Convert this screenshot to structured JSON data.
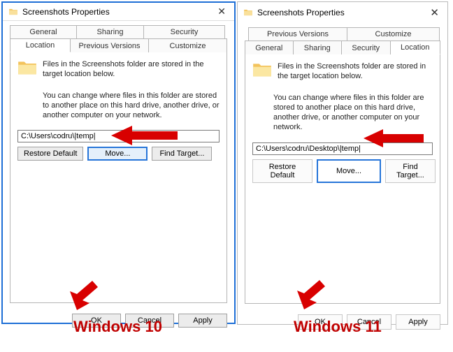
{
  "win10": {
    "title": "Screenshots Properties",
    "tabs_row1": [
      "General",
      "Sharing",
      "Security"
    ],
    "tabs_row2": [
      "Location",
      "Previous Versions",
      "Customize"
    ],
    "active_tab": "Location",
    "desc1": "Files in the Screenshots folder are stored in the target location below.",
    "desc2": "You can change where files in this folder are stored to another place on this hard drive, another drive, or another computer on your network.",
    "path": "C:\\Users\\codru\\|temp|",
    "buttons": {
      "restore": "Restore Default",
      "move": "Move...",
      "find": "Find Target..."
    },
    "footer": {
      "ok": "OK",
      "cancel": "Cancel",
      "apply": "Apply"
    }
  },
  "win11": {
    "title": "Screenshots Properties",
    "tabs_row1": [
      "Previous Versions",
      "Customize"
    ],
    "tabs_row2": [
      "General",
      "Sharing",
      "Security",
      "Location"
    ],
    "active_tab": "Location",
    "desc1": "Files in the Screenshots folder are stored in the target location below.",
    "desc2": "You can change where files in this folder are stored to another place on this hard drive, another drive, or another computer on your network.",
    "path": "C:\\Users\\codru\\Desktop\\|temp|",
    "buttons": {
      "restore": "Restore Default",
      "move": "Move...",
      "find": "Find Target..."
    },
    "footer": {
      "ok": "OK",
      "cancel": "Cancel",
      "apply": "Apply"
    }
  },
  "captions": {
    "w10": "Windows 10",
    "w11": "Windows 11"
  }
}
